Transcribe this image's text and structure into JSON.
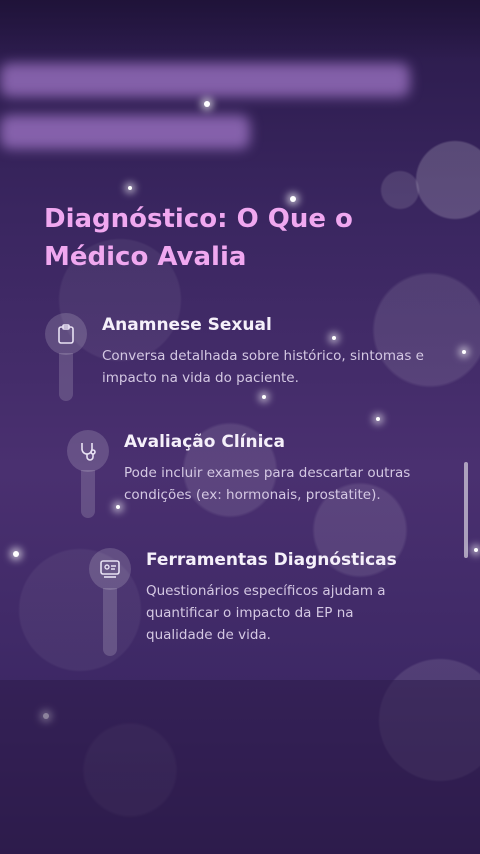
{
  "page": {
    "title": "Diagnóstico: O Que o Médico Avalia"
  },
  "items": [
    {
      "title": "Anamnese Sexual",
      "description": "Conversa detalhada sobre histórico, sintomas e impacto na vida do paciente.",
      "icon": "clipboard-icon"
    },
    {
      "title": "Avaliação Clínica",
      "description": "Pode incluir exames para descartar outras condições (ex: hormonais, prostatite).",
      "icon": "stethoscope-icon"
    },
    {
      "title": "Ferramentas Diagnósticas",
      "description": "Questionários específicos ajudam a quantificar o impacto da EP na qualidade de vida.",
      "icon": "questionnaire-icon"
    }
  ],
  "colors": {
    "title": "#f0a8f0",
    "background": "#3a2660",
    "text": "#d4c8e3"
  }
}
